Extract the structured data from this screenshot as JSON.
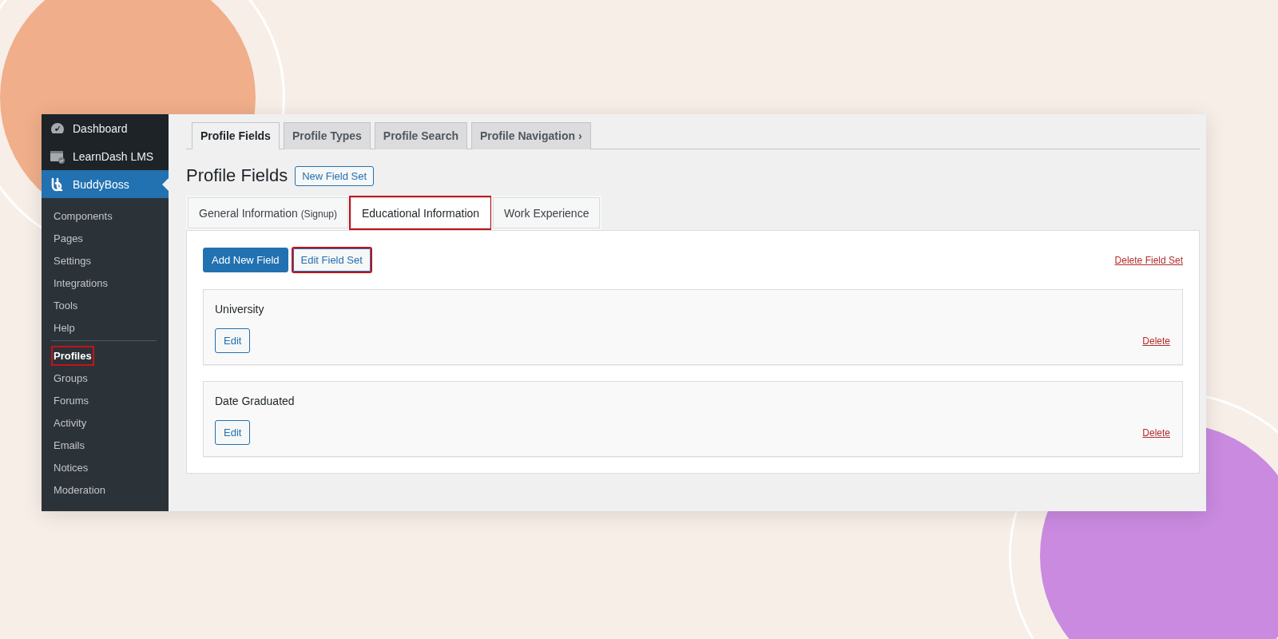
{
  "sidebar": {
    "menu": [
      {
        "label": "Dashboard",
        "kind": "gauge",
        "selected": false
      },
      {
        "label": "LearnDash LMS",
        "kind": "window",
        "selected": false
      },
      {
        "label": "BuddyBoss",
        "kind": "logo",
        "selected": true
      }
    ],
    "submenu": [
      {
        "label": "Components",
        "selected": false,
        "highlighted": false
      },
      {
        "label": "Pages",
        "selected": false,
        "highlighted": false
      },
      {
        "label": "Settings",
        "selected": false,
        "highlighted": false
      },
      {
        "label": "Integrations",
        "selected": false,
        "highlighted": false
      },
      {
        "label": "Tools",
        "selected": false,
        "highlighted": false
      },
      {
        "label": "Help",
        "selected": false,
        "highlighted": false
      },
      {
        "label": "Profiles",
        "selected": true,
        "highlighted": true
      },
      {
        "label": "Groups",
        "selected": false,
        "highlighted": false
      },
      {
        "label": "Forums",
        "selected": false,
        "highlighted": false
      },
      {
        "label": "Activity",
        "selected": false,
        "highlighted": false
      },
      {
        "label": "Emails",
        "selected": false,
        "highlighted": false
      },
      {
        "label": "Notices",
        "selected": false,
        "highlighted": false
      },
      {
        "label": "Moderation",
        "selected": false,
        "highlighted": false
      }
    ]
  },
  "nav_tabs": [
    {
      "label": "Profile Fields",
      "selected": true
    },
    {
      "label": "Profile Types",
      "selected": false
    },
    {
      "label": "Profile Search",
      "selected": false
    },
    {
      "label": "Profile Navigation",
      "selected": false,
      "chevron": "›"
    }
  ],
  "heading": {
    "title": "Profile Fields",
    "button": "New Field Set"
  },
  "field_tabs": [
    {
      "label": "General Information",
      "note": "(Signup)",
      "selected": false,
      "highlighted": false
    },
    {
      "label": "Educational Information",
      "selected": true,
      "highlighted": true
    },
    {
      "label": "Work Experience",
      "selected": false,
      "highlighted": false
    }
  ],
  "actions": {
    "add_button": "Add New Field",
    "edit_button": "Edit Field Set",
    "edit_highlighted": true,
    "delete_link": "Delete Field Set"
  },
  "fields": [
    {
      "name": "University",
      "edit": "Edit",
      "delete": "Delete"
    },
    {
      "name": "Date Graduated",
      "edit": "Edit",
      "delete": "Delete"
    }
  ]
}
